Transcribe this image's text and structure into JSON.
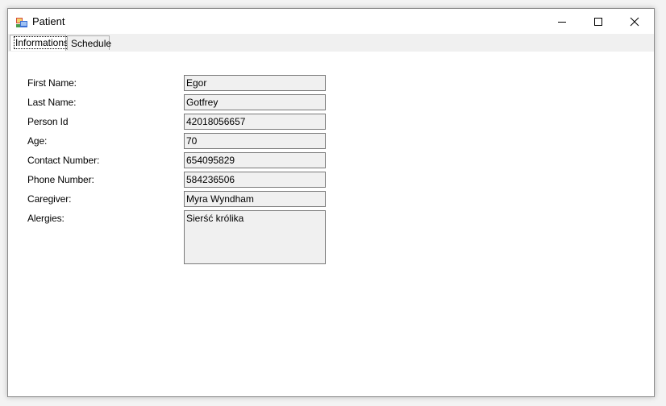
{
  "window": {
    "title": "Patient"
  },
  "tabs": [
    {
      "label": "Informations"
    },
    {
      "label": "Schedule"
    }
  ],
  "form": {
    "first_name": {
      "label": "First Name:",
      "value": "Egor"
    },
    "last_name": {
      "label": "Last Name:",
      "value": "Gotfrey"
    },
    "person_id": {
      "label": "Person Id",
      "value": "42018056657"
    },
    "age": {
      "label": "Age:",
      "value": "70"
    },
    "contact_number": {
      "label": "Contact Number:",
      "value": "654095829"
    },
    "phone_number": {
      "label": "Phone Number:",
      "value": "584236506"
    },
    "caregiver": {
      "label": "Caregiver:",
      "value": "Myra Wyndham"
    },
    "allergies": {
      "label": "Alergies:",
      "value": "Sierść królika"
    }
  },
  "colors": {
    "field_background": "#f0f0f0",
    "field_border": "#7a7a7a",
    "tabstrip_background": "#f0f0f0"
  },
  "icons": {
    "app": "patient-app-icon",
    "minimize": "minimize-icon",
    "maximize": "maximize-icon",
    "close": "close-icon"
  }
}
